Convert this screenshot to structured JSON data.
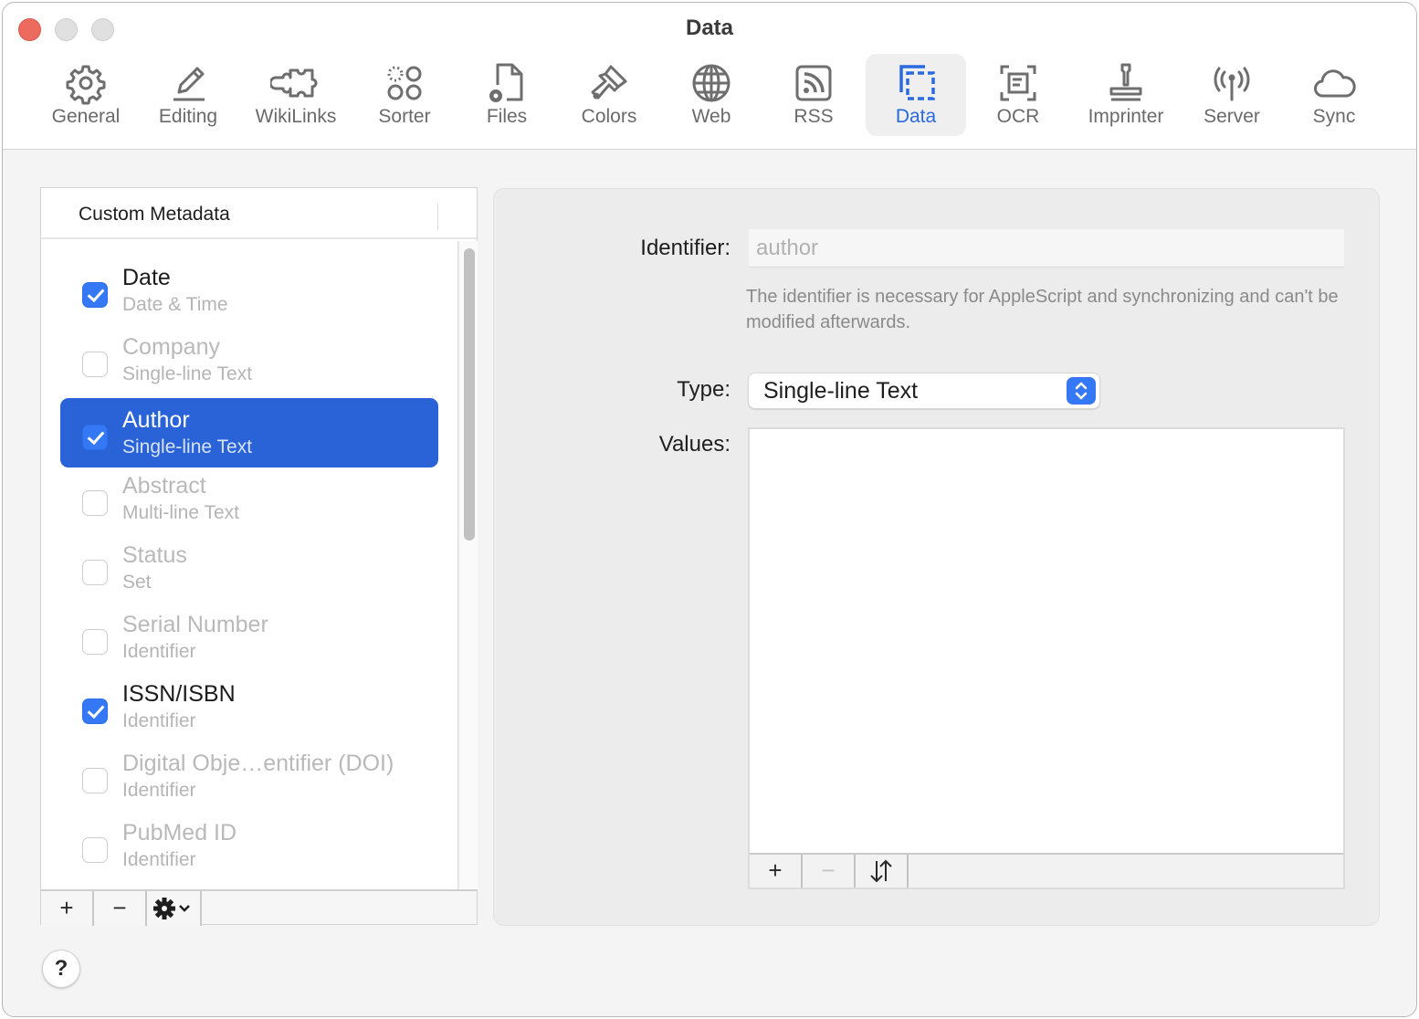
{
  "window": {
    "title": "Data"
  },
  "toolbar": {
    "items": [
      {
        "label": "General",
        "icon": "gear-icon"
      },
      {
        "label": "Editing",
        "icon": "pencil-icon"
      },
      {
        "label": "WikiLinks",
        "icon": "puzzle-icon"
      },
      {
        "label": "Sorter",
        "icon": "sorter-circles-icon"
      },
      {
        "label": "Files",
        "icon": "file-gear-icon"
      },
      {
        "label": "Colors",
        "icon": "paintbrush-icon"
      },
      {
        "label": "Web",
        "icon": "globe-icon"
      },
      {
        "label": "RSS",
        "icon": "rss-icon"
      },
      {
        "label": "Data",
        "icon": "data-icon",
        "active": true
      },
      {
        "label": "OCR",
        "icon": "ocr-scan-icon"
      },
      {
        "label": "Imprinter",
        "icon": "stamp-icon"
      },
      {
        "label": "Server",
        "icon": "antenna-icon"
      },
      {
        "label": "Sync",
        "icon": "cloud-icon"
      }
    ],
    "accent_color": "#2a6adf"
  },
  "metadata_list": {
    "header": "Custom Metadata",
    "items": [
      {
        "name": "Date",
        "type": "Date & Time",
        "checked": true,
        "selected": false
      },
      {
        "name": "Company",
        "type": "Single-line Text",
        "checked": false,
        "selected": false
      },
      {
        "name": "Author",
        "type": "Single-line Text",
        "checked": true,
        "selected": true
      },
      {
        "name": "Abstract",
        "type": "Multi-line Text",
        "checked": false,
        "selected": false
      },
      {
        "name": "Status",
        "type": "Set",
        "checked": false,
        "selected": false
      },
      {
        "name": "Serial Number",
        "type": "Identifier",
        "checked": false,
        "selected": false
      },
      {
        "name": "ISSN/ISBN",
        "type": "Identifier",
        "checked": true,
        "selected": false
      },
      {
        "name": "Digital Obje…entifier (DOI)",
        "type": "Identifier",
        "checked": false,
        "selected": false
      },
      {
        "name": "PubMed ID",
        "type": "Identifier",
        "checked": false,
        "selected": false
      }
    ],
    "footer": {
      "add_label": "+",
      "remove_label": "−",
      "action_icon": "gear-menu-icon"
    },
    "selection_color": "#2a62d8"
  },
  "detail": {
    "identifier_label": "Identifier:",
    "identifier_value": "author",
    "identifier_note": "The identifier is necessary for AppleScript and synchronizing and can't be modified afterwards.",
    "type_label": "Type:",
    "type_value": "Single-line Text",
    "values_label": "Values:",
    "values": [],
    "values_footer": {
      "add_label": "+",
      "remove_label": "−",
      "sort_label": "↓↑"
    }
  },
  "help": {
    "label": "?"
  }
}
